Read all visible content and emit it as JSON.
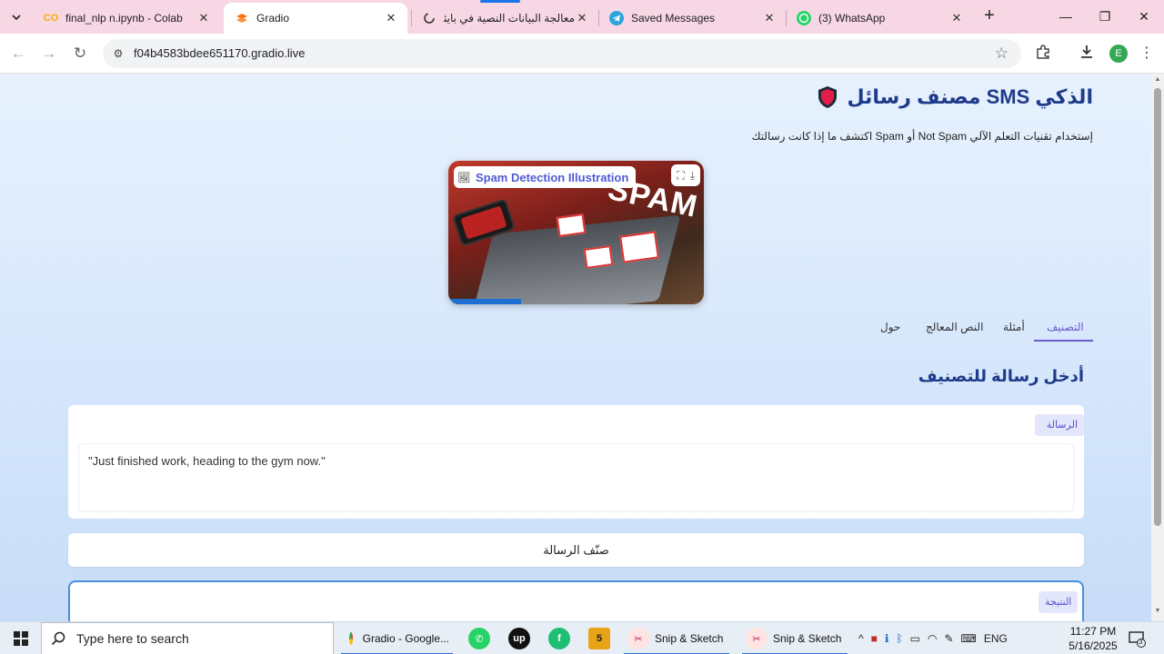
{
  "browser": {
    "tabs": [
      {
        "title": "final_nlp n.ipynb - Colab",
        "icon": "colab-icon",
        "active": false
      },
      {
        "title": "Gradio",
        "icon": "gradio-icon",
        "active": true
      },
      {
        "title": "معالجة البيانات النصية في بايثون",
        "icon": "loading-icon",
        "active": false
      },
      {
        "title": "Saved Messages",
        "icon": "telegram-icon",
        "active": false
      },
      {
        "title": "(3) WhatsApp",
        "icon": "whatsapp-icon",
        "active": false
      }
    ],
    "url": "f04b4583bdee651170.gradio.live",
    "profile_initial": "E"
  },
  "app": {
    "title_text": "الذكي SMS مصنف رسائل",
    "subtitle": "إستخدام تقنيات التعلم الآلي Not Spam أو Spam اكتشف ما إذا كانت رسالتك",
    "image_label": "Spam Detection Illustration",
    "image_word": "SPAM",
    "nav_tabs": [
      {
        "label": "التصنيف",
        "active": true
      },
      {
        "label": "أمثلة",
        "active": false
      },
      {
        "label": "النص المعالج",
        "active": false
      },
      {
        "label": "حول",
        "active": false
      }
    ],
    "section_title": "أدخل رسالة للتصنيف",
    "message_label": "الرسالة",
    "message_value": "\"Just finished work, heading to the gym now.\"",
    "classify_button": "صنّف الرسالة",
    "result_label": "النتيجة"
  },
  "colors": {
    "accent": "#6a5acd",
    "title": "#1e3a8a",
    "result_border": "#4a90d9"
  },
  "taskbar": {
    "search_placeholder": "Type here to search",
    "apps": [
      {
        "label": "Gradio - Google...",
        "icon": "chrome-icon"
      },
      {
        "label": "",
        "icon": "whatsapp-icon"
      },
      {
        "label": "",
        "icon": "upwork-icon"
      },
      {
        "label": "",
        "icon": "fiverr-icon"
      },
      {
        "label": "",
        "icon": "app-5-icon"
      },
      {
        "label": "Snip & Sketch",
        "icon": "snip-icon"
      },
      {
        "label": "Snip & Sketch",
        "icon": "snip-icon"
      }
    ],
    "language": "ENG",
    "time": "11:27 PM",
    "date": "5/16/2025",
    "notifications": "3"
  }
}
